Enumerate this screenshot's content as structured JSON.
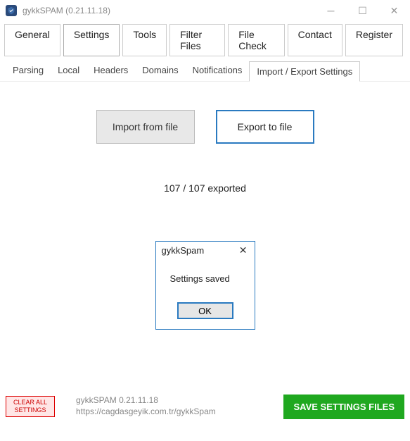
{
  "window": {
    "title": "gykkSPAM  (0.21.11.18)"
  },
  "mainTabs": {
    "t0": "General",
    "t1": "Settings",
    "t2": "Tools",
    "t3": "Filter Files",
    "t4": "File Check",
    "t5": "Contact",
    "t6": "Register"
  },
  "subTabs": {
    "s0": "Parsing",
    "s1": "Local",
    "s2": "Headers",
    "s3": "Domains",
    "s4": "Notifications",
    "s5": "Import / Export Settings"
  },
  "buttons": {
    "import": "Import from file",
    "export": "Export to file"
  },
  "status": "107 / 107 exported",
  "modal": {
    "title": "gykkSpam",
    "message": "Settings saved",
    "ok": "OK"
  },
  "footer": {
    "clear1": "CLEAR ALL",
    "clear2": "SETTINGS",
    "line1": "gykkSPAM 0.21.11.18",
    "line2": "https://cagdasgeyik.com.tr/gykkSpam",
    "save": "SAVE SETTINGS FILES"
  }
}
